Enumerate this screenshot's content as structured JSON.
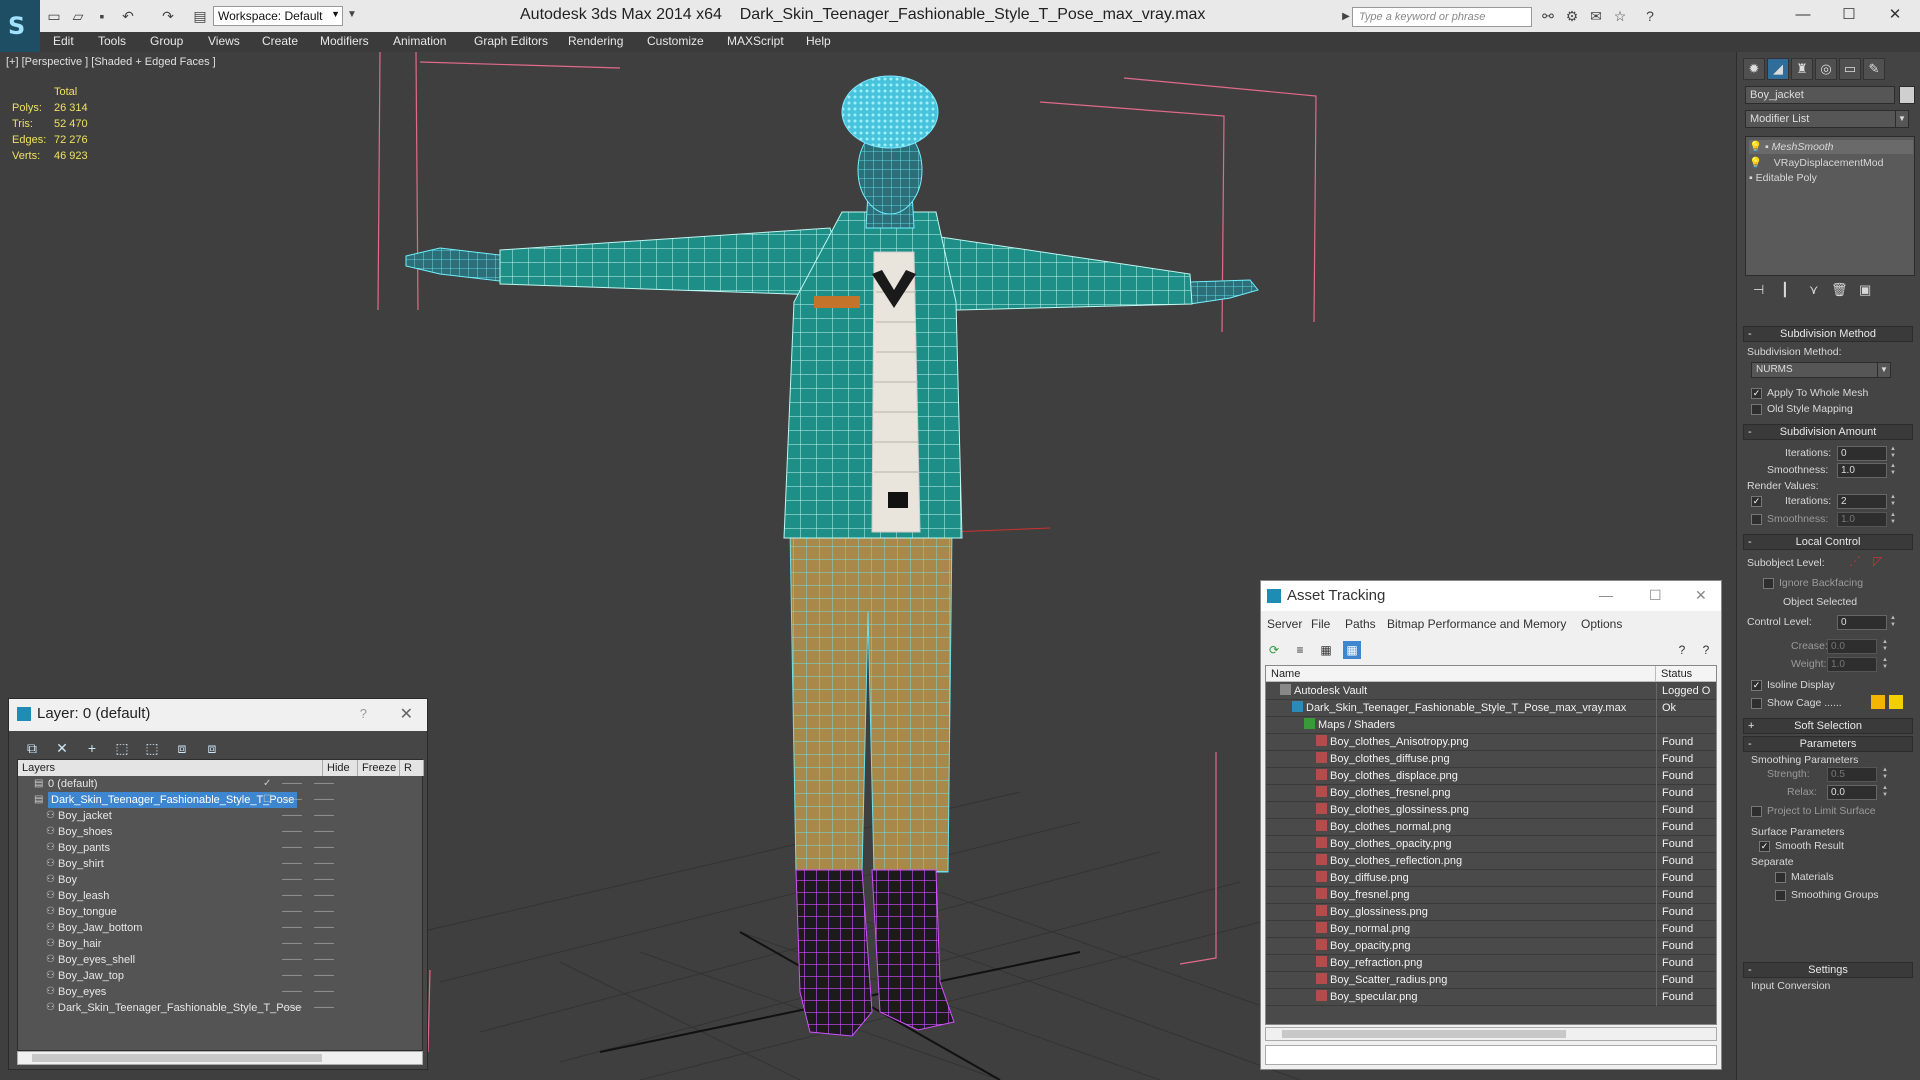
{
  "titlebar": {
    "app": "Autodesk 3ds Max  2014 x64",
    "file": "Dark_Skin_Teenager_Fashionable_Style_T_Pose_max_vray.max",
    "workspace": "Workspace: Default",
    "search_placeholder": "Type a keyword or phrase"
  },
  "menu": [
    "Edit",
    "Tools",
    "Group",
    "Views",
    "Create",
    "Modifiers",
    "Animation",
    "Graph Editors",
    "Rendering",
    "Customize",
    "MAXScript",
    "Help"
  ],
  "viewport": {
    "label": "[+] [Perspective ] [Shaded + Edged Faces ]",
    "stats": {
      "total": "Total",
      "polys_label": "Polys:",
      "polys": "26 314",
      "tris_label": "Tris:",
      "tris": "52 470",
      "edges_label": "Edges:",
      "edges": "72 276",
      "verts_label": "Verts:",
      "verts": "46 923"
    }
  },
  "command_panel": {
    "object_name": "Boy_jacket",
    "modifier_list": "Modifier List",
    "stack": [
      "MeshSmooth",
      "VRayDisplacementMod",
      "Editable Poly"
    ],
    "subdivision_method": {
      "title": "Subdivision Method",
      "label": "Subdivision Method:",
      "value": "NURMS",
      "apply_whole": "Apply To Whole Mesh",
      "old_style": "Old Style Mapping"
    },
    "subdivision_amount": {
      "title": "Subdivision Amount",
      "iterations_label": "Iterations:",
      "iterations": "0",
      "smoothness_label": "Smoothness:",
      "smoothness": "1.0",
      "render_values": "Render Values:",
      "r_iterations_label": "Iterations:",
      "r_iterations": "2",
      "r_smoothness_label": "Smoothness:",
      "r_smoothness": "1.0"
    },
    "local_control": {
      "title": "Local Control",
      "subobject_label": "Subobject Level:",
      "ignore_backfacing": "Ignore Backfacing",
      "object_selected": "Object Selected",
      "control_level_label": "Control Level:",
      "control_level": "0",
      "crease_label": "Crease:",
      "crease": "0.0",
      "weight_label": "Weight:",
      "weight": "1.0",
      "isoline": "Isoline Display",
      "show_cage": "Show Cage ......"
    },
    "soft_selection": "Soft Selection",
    "parameters": {
      "title": "Parameters",
      "smoothing_params": "Smoothing Parameters",
      "strength_label": "Strength:",
      "strength": "0.5",
      "relax_label": "Relax:",
      "relax": "0.0",
      "project_limit": "Project to Limit Surface",
      "surface_params": "Surface Parameters",
      "smooth_result": "Smooth Result",
      "separate": "Separate",
      "materials": "Materials",
      "smoothing_groups": "Smoothing Groups"
    },
    "settings": "Settings",
    "input_conversion": "Input Conversion"
  },
  "layer_panel": {
    "title": "Layer: 0 (default)",
    "help": "?",
    "columns": [
      "Layers",
      "Hide",
      "Freeze",
      "R"
    ],
    "rows": [
      {
        "name": "0 (default)",
        "level": 0
      },
      {
        "name": "Dark_Skin_Teenager_Fashionable_Style_T_Pose",
        "level": 0
      },
      {
        "name": "Boy_jacket",
        "level": 1
      },
      {
        "name": "Boy_shoes",
        "level": 1
      },
      {
        "name": "Boy_pants",
        "level": 1
      },
      {
        "name": "Boy_shirt",
        "level": 1
      },
      {
        "name": "Boy",
        "level": 1
      },
      {
        "name": "Boy_leash",
        "level": 1
      },
      {
        "name": "Boy_tongue",
        "level": 1
      },
      {
        "name": "Boy_Jaw_bottom",
        "level": 1
      },
      {
        "name": "Boy_hair",
        "level": 1
      },
      {
        "name": "Boy_eyes_shell",
        "level": 1
      },
      {
        "name": "Boy_Jaw_top",
        "level": 1
      },
      {
        "name": "Boy_eyes",
        "level": 1
      },
      {
        "name": "Dark_Skin_Teenager_Fashionable_Style_T_Pose",
        "level": 1
      }
    ]
  },
  "asset_tracking": {
    "title": "Asset Tracking",
    "menu": [
      "Server",
      "File",
      "Paths",
      "Bitmap Performance and Memory",
      "Options"
    ],
    "columns": [
      "Name",
      "Status"
    ],
    "rows": [
      {
        "name": "Autodesk Vault",
        "status": "Logged O",
        "level": 0,
        "kind": "vault"
      },
      {
        "name": "Dark_Skin_Teenager_Fashionable_Style_T_Pose_max_vray.max",
        "status": "Ok",
        "level": 1,
        "kind": "max"
      },
      {
        "name": "Maps / Shaders",
        "status": "",
        "level": 2,
        "kind": "maps"
      },
      {
        "name": "Boy_clothes_Anisotropy.png",
        "status": "Found",
        "level": 3,
        "kind": "png"
      },
      {
        "name": "Boy_clothes_diffuse.png",
        "status": "Found",
        "level": 3,
        "kind": "png"
      },
      {
        "name": "Boy_clothes_displace.png",
        "status": "Found",
        "level": 3,
        "kind": "png"
      },
      {
        "name": "Boy_clothes_fresnel.png",
        "status": "Found",
        "level": 3,
        "kind": "png"
      },
      {
        "name": "Boy_clothes_glossiness.png",
        "status": "Found",
        "level": 3,
        "kind": "png"
      },
      {
        "name": "Boy_clothes_normal.png",
        "status": "Found",
        "level": 3,
        "kind": "png"
      },
      {
        "name": "Boy_clothes_opacity.png",
        "status": "Found",
        "level": 3,
        "kind": "png"
      },
      {
        "name": "Boy_clothes_reflection.png",
        "status": "Found",
        "level": 3,
        "kind": "png"
      },
      {
        "name": "Boy_diffuse.png",
        "status": "Found",
        "level": 3,
        "kind": "png"
      },
      {
        "name": "Boy_fresnel.png",
        "status": "Found",
        "level": 3,
        "kind": "png"
      },
      {
        "name": "Boy_glossiness.png",
        "status": "Found",
        "level": 3,
        "kind": "png"
      },
      {
        "name": "Boy_normal.png",
        "status": "Found",
        "level": 3,
        "kind": "png"
      },
      {
        "name": "Boy_opacity.png",
        "status": "Found",
        "level": 3,
        "kind": "png"
      },
      {
        "name": "Boy_refraction.png",
        "status": "Found",
        "level": 3,
        "kind": "png"
      },
      {
        "name": "Boy_Scatter_radius.png",
        "status": "Found",
        "level": 3,
        "kind": "png"
      },
      {
        "name": "Boy_specular.png",
        "status": "Found",
        "level": 3,
        "kind": "png"
      }
    ]
  },
  "colors": {
    "wire": "#4fd4e0",
    "jacket": "#1e8f86",
    "pants": "#a8894a",
    "boots": "#b43ad0",
    "selection": "#3e86d0",
    "stats": "#f0e060"
  }
}
